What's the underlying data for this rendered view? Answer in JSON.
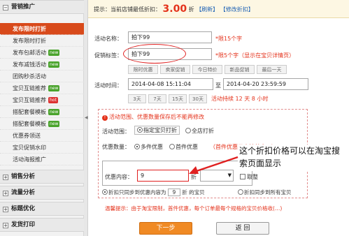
{
  "sidebar": {
    "sections": [
      "营销推广",
      "销售分析",
      "流量分析",
      "标题优化",
      "发货打印"
    ],
    "items": [
      {
        "label": "发布限时打折",
        "tag": ""
      },
      {
        "label": "发布限时打折",
        "tag": ""
      },
      {
        "label": "发布包邮活动",
        "tag": "new"
      },
      {
        "label": "发布减钱活动",
        "tag": "new"
      },
      {
        "label": "团购秒杀活动",
        "tag": ""
      },
      {
        "label": "宝贝互链推荐",
        "tag": "new"
      },
      {
        "label": "宝贝互链推荐",
        "tag": "hot"
      },
      {
        "label": "搭配套餐模板",
        "tag": "new"
      },
      {
        "label": "搭配套餐模板",
        "tag": "new"
      },
      {
        "label": "优惠券领送",
        "tag": ""
      },
      {
        "label": "宝贝促销水印",
        "tag": ""
      },
      {
        "label": "活动海报推广",
        "tag": ""
      }
    ]
  },
  "topbar": {
    "prefix": "提示：当前店铺最低折扣：",
    "discount": "3.00",
    "unit": "折",
    "refresh": "【刷新】",
    "modify": "【修改折扣】"
  },
  "form": {
    "name_label": "活动名称：",
    "name_value": "拍下99",
    "name_hint": "*限15个字",
    "tag_label": "促销标签：",
    "tag_value": "拍下99",
    "tag_hint": "*限5个字（显示在宝贝详情页）",
    "tag_options": [
      "限时优惠",
      "卖家促销",
      "今日特价",
      "新品促销",
      "最后一天"
    ],
    "time_label": "活动时间：",
    "start": "2014-04-08 15:11:04",
    "to": "至",
    "end": "2014-04-20 23:59:59",
    "durations": [
      "3天",
      "7天",
      "15天",
      "30天"
    ],
    "remain": "活动持续 12 天 8 小时",
    "notice": "活动范围、优惠数量保存后不能再修改",
    "scope_label": "活动范围：",
    "scope_opts": [
      "指定宝贝打折",
      "全店打折"
    ],
    "qty_label": "优惠数量：",
    "qty_opts": [
      "多件优惠",
      "首件优惠"
    ],
    "qty_note": "（首件优惠只支持单个…）",
    "content_label": "优惠内容：",
    "content_value": "9",
    "content_unit": "折",
    "round": "取整",
    "sync_opts": [
      "折扣只同步到优惠内容为",
      "9",
      "折 的宝贝",
      "折扣同步到所有宝贝"
    ],
    "tip": "温馨提示：由于淘宝限制，首件优惠，每个订单最每个规格的宝贝价格收(…)",
    "next": "下一步",
    "back": "返 回"
  },
  "annotation": "这个折扣价格可以在淘宝搜索页面显示",
  "colors": {
    "accent": "#e4321b",
    "active": "#d84a1b",
    "next_btn": "#f08a24"
  }
}
